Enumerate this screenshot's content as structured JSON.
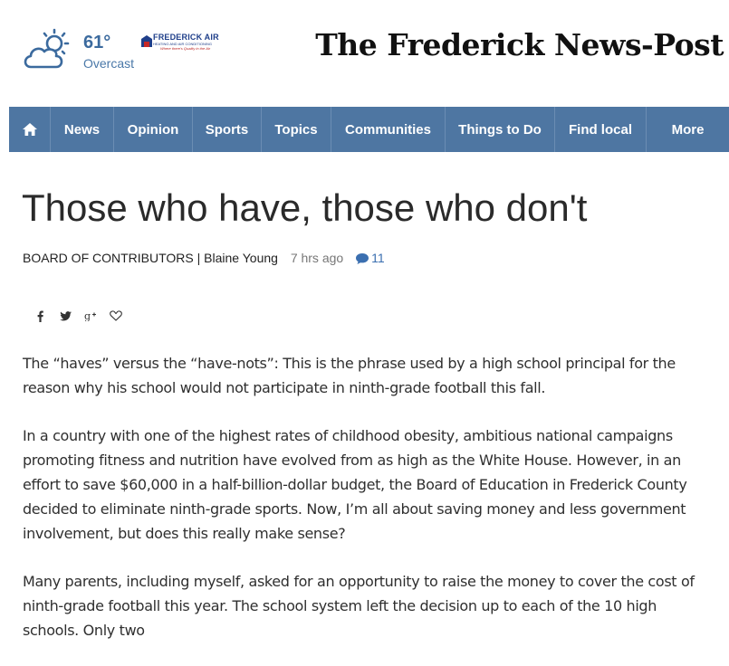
{
  "weather": {
    "temperature": "61°",
    "condition": "Overcast",
    "icon": "cloud-sun-icon"
  },
  "sponsor": {
    "name": "FREDERICK AIR",
    "subtitle": "HEATING AND AIR CONDITIONING",
    "tagline": "Where there's Quality in the Air"
  },
  "brand": {
    "name": "The Frederick News-Post"
  },
  "nav": {
    "home_icon": "home-icon",
    "items": [
      "News",
      "Opinion",
      "Sports",
      "Topics",
      "Communities",
      "Things to Do",
      "Find local",
      "More"
    ]
  },
  "article": {
    "title": "Those who have, those who don't",
    "section": "BOARD OF CONTRIBUTORS | Blaine Young",
    "time": "7 hrs ago",
    "comment_count": "11",
    "share_icons": [
      "facebook-icon",
      "twitter-icon",
      "google-plus-icon",
      "heart-icon"
    ],
    "paragraphs": [
      "The “haves” versus the “have-nots”: This is the phrase used by a high school principal for the reason why his school would not participate in ninth-grade football this fall.",
      "In a country with one of the highest rates of childhood obesity, ambitious national campaigns promoting fitness and nutrition have evolved from as high as the White House. However, in an effort to save $60,000 in a half-billion-dollar budget, the Board of Education in Frederick County decided to eliminate ninth-grade sports. Now, I’m all about saving money and less government involvement, but does this really make sense?",
      "Many parents, including myself, asked for an opportunity to raise the money to cover the cost of ninth-grade football this year. The school system left the decision up to each of the 10 high schools. Only two"
    ]
  },
  "colors": {
    "nav_background": "#4e76a2",
    "weather_blue": "#3b6a9e",
    "comment_link": "#3b6fb0"
  }
}
